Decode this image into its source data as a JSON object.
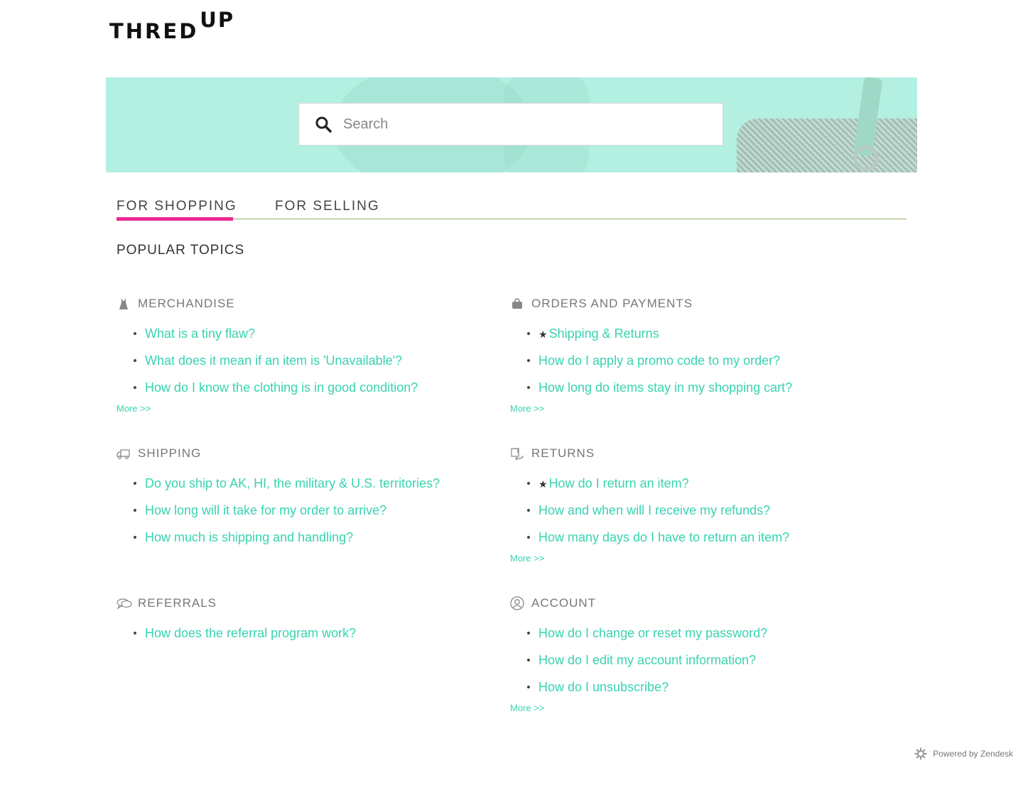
{
  "brand": {
    "logo_main": "THRED",
    "logo_sup": "UP"
  },
  "search": {
    "placeholder": "Search"
  },
  "tabs": [
    {
      "label": "FOR SHOPPING",
      "active": true
    },
    {
      "label": "FOR SELLING",
      "active": false
    }
  ],
  "popular_title": "POPULAR TOPICS",
  "sections": {
    "merchandise": {
      "title": "MERCHANDISE",
      "icon": "dress-icon",
      "items": [
        "What is a tiny flaw?",
        "What does it mean if an item is 'Unavailable'?",
        "How do I know the clothing is in good condition?"
      ],
      "more": "More >>"
    },
    "orders": {
      "title": "ORDERS AND PAYMENTS",
      "icon": "bag-icon",
      "items": [
        "Shipping & Returns",
        "How do I apply a promo code to my order?",
        "How long do items stay in my shopping cart?"
      ],
      "more": "More >>"
    },
    "shipping": {
      "title": "SHIPPING",
      "icon": "truck-icon",
      "items": [
        "Do you ship to AK, HI, the military & U.S. territories?",
        "How long will it take for my order to arrive?",
        "How much is shipping and handling?"
      ]
    },
    "returns": {
      "title": "RETURNS",
      "icon": "return-icon",
      "items": [
        "How do I return an item?",
        "How and when will I receive my refunds?",
        "How many days do I have to return an item?"
      ],
      "more": "More >>"
    },
    "referrals": {
      "title": "REFERRALS",
      "icon": "chat-icon",
      "items": [
        "How does the referral program work?"
      ]
    },
    "account": {
      "title": "ACCOUNT",
      "icon": "user-icon",
      "items": [
        "How do I change or reset my password?",
        "How do I edit my account information?",
        "How do I unsubscribe?"
      ],
      "more": "More >>"
    }
  },
  "star_glyph": "★",
  "footer": {
    "text": "Powered by Zendesk"
  },
  "colors": {
    "accent": "#39d3b0",
    "tab_underline": "#ec2a93",
    "hero_bg": "#b3f0e1"
  }
}
